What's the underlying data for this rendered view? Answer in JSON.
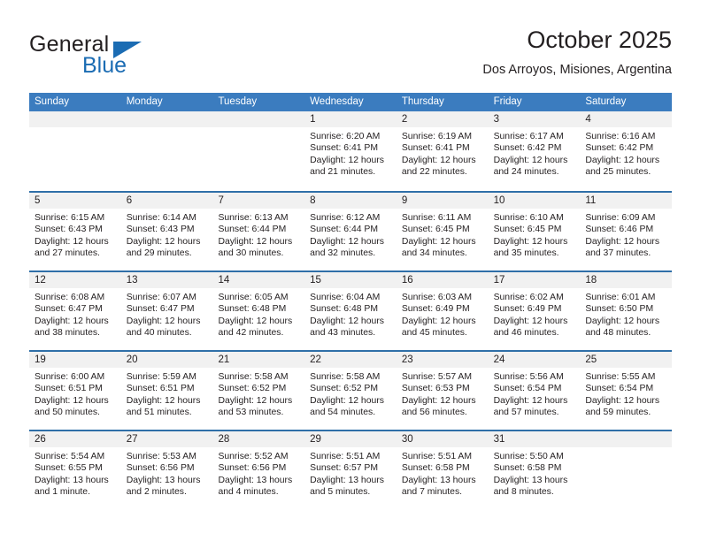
{
  "brand": {
    "name_part1": "General",
    "name_part2": "Blue",
    "triangle_icon": "triangle-icon",
    "accent_color": "#1b6cb3"
  },
  "header": {
    "title": "October 2025",
    "subtitle": "Dos Arroyos, Misiones, Argentina"
  },
  "colors": {
    "header_blue": "#3b7cbf",
    "separator_blue": "#2f6fa8",
    "daynum_band": "#f1f1f1",
    "text": "#231f20"
  },
  "weekdays": [
    "Sunday",
    "Monday",
    "Tuesday",
    "Wednesday",
    "Thursday",
    "Friday",
    "Saturday"
  ],
  "weeks": [
    [
      {
        "day": "",
        "sunrise": "",
        "sunset": "",
        "daylight1": "",
        "daylight2": ""
      },
      {
        "day": "",
        "sunrise": "",
        "sunset": "",
        "daylight1": "",
        "daylight2": ""
      },
      {
        "day": "",
        "sunrise": "",
        "sunset": "",
        "daylight1": "",
        "daylight2": ""
      },
      {
        "day": "1",
        "sunrise": "Sunrise: 6:20 AM",
        "sunset": "Sunset: 6:41 PM",
        "daylight1": "Daylight: 12 hours",
        "daylight2": "and 21 minutes."
      },
      {
        "day": "2",
        "sunrise": "Sunrise: 6:19 AM",
        "sunset": "Sunset: 6:41 PM",
        "daylight1": "Daylight: 12 hours",
        "daylight2": "and 22 minutes."
      },
      {
        "day": "3",
        "sunrise": "Sunrise: 6:17 AM",
        "sunset": "Sunset: 6:42 PM",
        "daylight1": "Daylight: 12 hours",
        "daylight2": "and 24 minutes."
      },
      {
        "day": "4",
        "sunrise": "Sunrise: 6:16 AM",
        "sunset": "Sunset: 6:42 PM",
        "daylight1": "Daylight: 12 hours",
        "daylight2": "and 25 minutes."
      }
    ],
    [
      {
        "day": "5",
        "sunrise": "Sunrise: 6:15 AM",
        "sunset": "Sunset: 6:43 PM",
        "daylight1": "Daylight: 12 hours",
        "daylight2": "and 27 minutes."
      },
      {
        "day": "6",
        "sunrise": "Sunrise: 6:14 AM",
        "sunset": "Sunset: 6:43 PM",
        "daylight1": "Daylight: 12 hours",
        "daylight2": "and 29 minutes."
      },
      {
        "day": "7",
        "sunrise": "Sunrise: 6:13 AM",
        "sunset": "Sunset: 6:44 PM",
        "daylight1": "Daylight: 12 hours",
        "daylight2": "and 30 minutes."
      },
      {
        "day": "8",
        "sunrise": "Sunrise: 6:12 AM",
        "sunset": "Sunset: 6:44 PM",
        "daylight1": "Daylight: 12 hours",
        "daylight2": "and 32 minutes."
      },
      {
        "day": "9",
        "sunrise": "Sunrise: 6:11 AM",
        "sunset": "Sunset: 6:45 PM",
        "daylight1": "Daylight: 12 hours",
        "daylight2": "and 34 minutes."
      },
      {
        "day": "10",
        "sunrise": "Sunrise: 6:10 AM",
        "sunset": "Sunset: 6:45 PM",
        "daylight1": "Daylight: 12 hours",
        "daylight2": "and 35 minutes."
      },
      {
        "day": "11",
        "sunrise": "Sunrise: 6:09 AM",
        "sunset": "Sunset: 6:46 PM",
        "daylight1": "Daylight: 12 hours",
        "daylight2": "and 37 minutes."
      }
    ],
    [
      {
        "day": "12",
        "sunrise": "Sunrise: 6:08 AM",
        "sunset": "Sunset: 6:47 PM",
        "daylight1": "Daylight: 12 hours",
        "daylight2": "and 38 minutes."
      },
      {
        "day": "13",
        "sunrise": "Sunrise: 6:07 AM",
        "sunset": "Sunset: 6:47 PM",
        "daylight1": "Daylight: 12 hours",
        "daylight2": "and 40 minutes."
      },
      {
        "day": "14",
        "sunrise": "Sunrise: 6:05 AM",
        "sunset": "Sunset: 6:48 PM",
        "daylight1": "Daylight: 12 hours",
        "daylight2": "and 42 minutes."
      },
      {
        "day": "15",
        "sunrise": "Sunrise: 6:04 AM",
        "sunset": "Sunset: 6:48 PM",
        "daylight1": "Daylight: 12 hours",
        "daylight2": "and 43 minutes."
      },
      {
        "day": "16",
        "sunrise": "Sunrise: 6:03 AM",
        "sunset": "Sunset: 6:49 PM",
        "daylight1": "Daylight: 12 hours",
        "daylight2": "and 45 minutes."
      },
      {
        "day": "17",
        "sunrise": "Sunrise: 6:02 AM",
        "sunset": "Sunset: 6:49 PM",
        "daylight1": "Daylight: 12 hours",
        "daylight2": "and 46 minutes."
      },
      {
        "day": "18",
        "sunrise": "Sunrise: 6:01 AM",
        "sunset": "Sunset: 6:50 PM",
        "daylight1": "Daylight: 12 hours",
        "daylight2": "and 48 minutes."
      }
    ],
    [
      {
        "day": "19",
        "sunrise": "Sunrise: 6:00 AM",
        "sunset": "Sunset: 6:51 PM",
        "daylight1": "Daylight: 12 hours",
        "daylight2": "and 50 minutes."
      },
      {
        "day": "20",
        "sunrise": "Sunrise: 5:59 AM",
        "sunset": "Sunset: 6:51 PM",
        "daylight1": "Daylight: 12 hours",
        "daylight2": "and 51 minutes."
      },
      {
        "day": "21",
        "sunrise": "Sunrise: 5:58 AM",
        "sunset": "Sunset: 6:52 PM",
        "daylight1": "Daylight: 12 hours",
        "daylight2": "and 53 minutes."
      },
      {
        "day": "22",
        "sunrise": "Sunrise: 5:58 AM",
        "sunset": "Sunset: 6:52 PM",
        "daylight1": "Daylight: 12 hours",
        "daylight2": "and 54 minutes."
      },
      {
        "day": "23",
        "sunrise": "Sunrise: 5:57 AM",
        "sunset": "Sunset: 6:53 PM",
        "daylight1": "Daylight: 12 hours",
        "daylight2": "and 56 minutes."
      },
      {
        "day": "24",
        "sunrise": "Sunrise: 5:56 AM",
        "sunset": "Sunset: 6:54 PM",
        "daylight1": "Daylight: 12 hours",
        "daylight2": "and 57 minutes."
      },
      {
        "day": "25",
        "sunrise": "Sunrise: 5:55 AM",
        "sunset": "Sunset: 6:54 PM",
        "daylight1": "Daylight: 12 hours",
        "daylight2": "and 59 minutes."
      }
    ],
    [
      {
        "day": "26",
        "sunrise": "Sunrise: 5:54 AM",
        "sunset": "Sunset: 6:55 PM",
        "daylight1": "Daylight: 13 hours",
        "daylight2": "and 1 minute."
      },
      {
        "day": "27",
        "sunrise": "Sunrise: 5:53 AM",
        "sunset": "Sunset: 6:56 PM",
        "daylight1": "Daylight: 13 hours",
        "daylight2": "and 2 minutes."
      },
      {
        "day": "28",
        "sunrise": "Sunrise: 5:52 AM",
        "sunset": "Sunset: 6:56 PM",
        "daylight1": "Daylight: 13 hours",
        "daylight2": "and 4 minutes."
      },
      {
        "day": "29",
        "sunrise": "Sunrise: 5:51 AM",
        "sunset": "Sunset: 6:57 PM",
        "daylight1": "Daylight: 13 hours",
        "daylight2": "and 5 minutes."
      },
      {
        "day": "30",
        "sunrise": "Sunrise: 5:51 AM",
        "sunset": "Sunset: 6:58 PM",
        "daylight1": "Daylight: 13 hours",
        "daylight2": "and 7 minutes."
      },
      {
        "day": "31",
        "sunrise": "Sunrise: 5:50 AM",
        "sunset": "Sunset: 6:58 PM",
        "daylight1": "Daylight: 13 hours",
        "daylight2": "and 8 minutes."
      },
      {
        "day": "",
        "sunrise": "",
        "sunset": "",
        "daylight1": "",
        "daylight2": ""
      }
    ]
  ]
}
